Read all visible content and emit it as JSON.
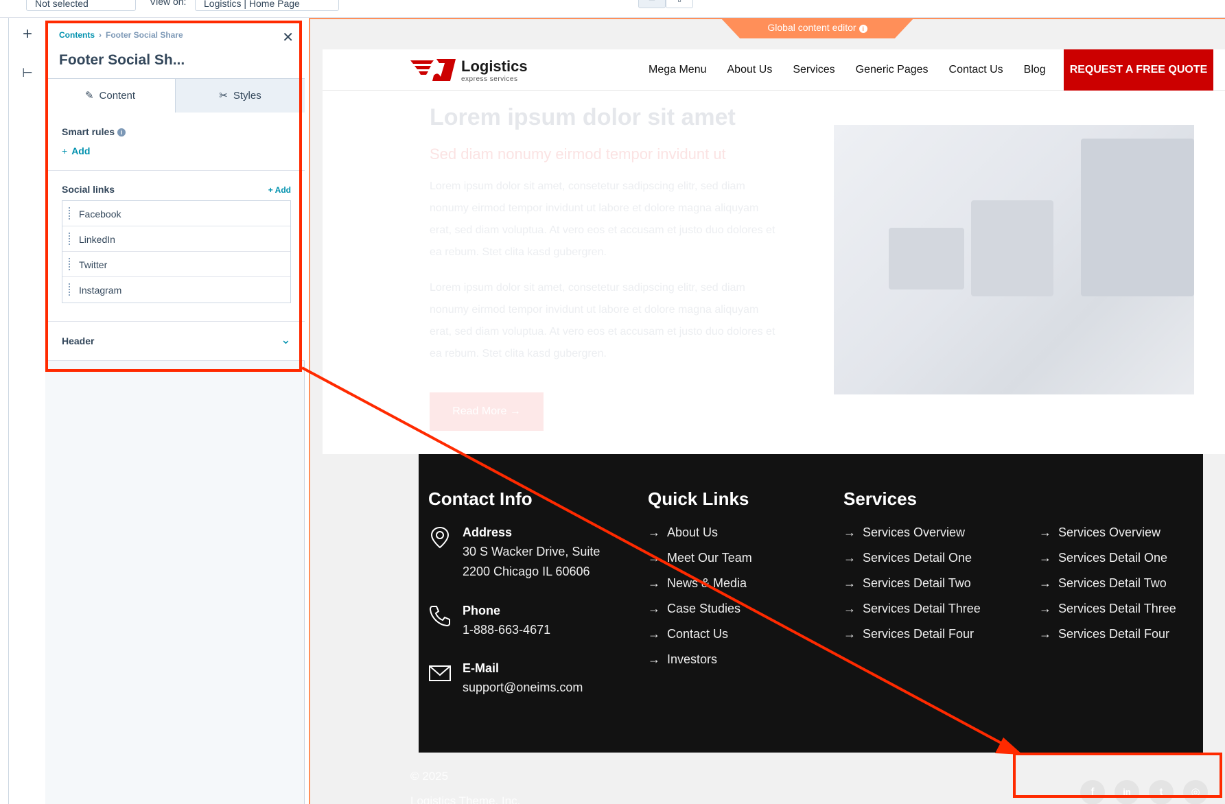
{
  "topbar": {
    "selector_value": "Not selected",
    "view_on_label": "View on:",
    "view_on_value": "Logistics | Home Page"
  },
  "sidebar": {
    "breadcrumb": [
      "Contents",
      "Footer Social Share"
    ],
    "title": "Footer Social Sh...",
    "tabs": [
      {
        "label": "Content"
      },
      {
        "label": "Styles"
      }
    ],
    "smart_rules": {
      "label": "Smart rules",
      "add": "Add"
    },
    "social_links": {
      "label": "Social links",
      "add": "+ Add",
      "items": [
        "Facebook",
        "LinkedIn",
        "Twitter",
        "Instagram"
      ]
    },
    "header_section": "Header"
  },
  "preview": {
    "global_editor_tab": "Global content editor",
    "logo": {
      "name": "Logistics",
      "tagline": "express services"
    },
    "nav": [
      "Mega Menu",
      "About Us",
      "Services",
      "Generic Pages",
      "Contact Us",
      "Blog"
    ],
    "cta": "REQUEST A FREE QUOTE",
    "hero": {
      "title": "Lorem ipsum dolor sit amet",
      "subtitle": "Sed diam nonumy eirmod tempor invidunt ut",
      "p1": "Lorem ipsum dolor sit amet, consetetur sadipscing elitr, sed diam nonumy eirmod tempor invidunt ut labore et dolore magna aliquyam erat, sed diam voluptua. At vero eos et accusam et justo duo dolores et ea rebum. Stet clita kasd gubergren.",
      "p2": "Lorem ipsum dolor sit amet, consetetur sadipscing elitr, sed diam nonumy eirmod tempor invidunt ut labore et dolore magna aliquyam erat, sed diam voluptua. At vero eos et accusam et justo duo dolores et ea rebum. Stet clita kasd gubergren.",
      "button": "Read More"
    },
    "footer": {
      "contact_heading": "Contact Info",
      "address_label": "Address",
      "address_line1": "30 S Wacker Drive, Suite",
      "address_line2": "2200 Chicago IL 60606",
      "phone_label": "Phone",
      "phone_value": "1-888-663-4671",
      "email_label": "E-Mail",
      "email_value": "support@oneims.com",
      "quick_heading": "Quick Links",
      "quick_links": [
        "About Us",
        "Meet Our Team",
        "News & Media",
        "Case Studies",
        "Contact Us",
        "Investors"
      ],
      "services_heading": "Services",
      "services_a": [
        "Services Overview",
        "Services Detail One",
        "Services Detail Two",
        "Services Detail Three",
        "Services Detail Four"
      ],
      "services_b": [
        "Services Overview",
        "Services Detail One",
        "Services Detail Two",
        "Services Detail Three",
        "Services Detail Four"
      ]
    },
    "copyright": "© 2025",
    "company": "Logistics Theme, Inc.",
    "social_icons": [
      "facebook-icon",
      "linkedin-icon",
      "twitter-icon",
      "instagram-icon"
    ]
  },
  "colors": {
    "accent_red": "#cc0000",
    "editor_orange": "#ff8f59",
    "annotation_red": "#ff2a00",
    "link_teal": "#0091ae"
  }
}
